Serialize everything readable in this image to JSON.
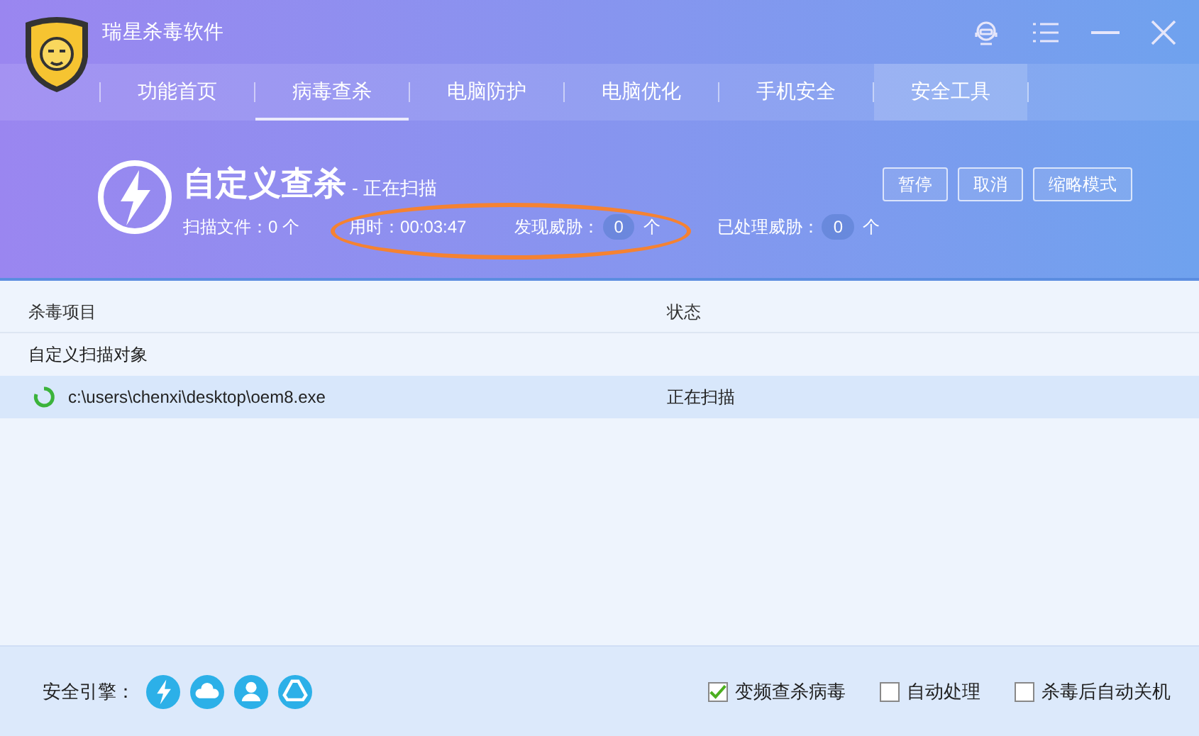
{
  "window": {
    "title": "瑞星杀毒软件"
  },
  "tabs": [
    {
      "label": "功能首页",
      "selected": false,
      "hovered": false
    },
    {
      "label": "病毒查杀",
      "selected": true,
      "hovered": false
    },
    {
      "label": "电脑防护",
      "selected": false,
      "hovered": false
    },
    {
      "label": "电脑优化",
      "selected": false,
      "hovered": false
    },
    {
      "label": "手机安全",
      "selected": false,
      "hovered": false
    },
    {
      "label": "安全工具",
      "selected": false,
      "hovered": true
    }
  ],
  "scan": {
    "title": "自定义查杀",
    "subtitle": "- 正在扫描",
    "stats": [
      {
        "label": "扫描文件：0 个",
        "kind": "plain"
      },
      {
        "label": "用时：00:03:47",
        "kind": "plain"
      },
      {
        "label": "发现威胁：",
        "count": "0",
        "unit": "个",
        "kind": "badge"
      },
      {
        "label": "已处理威胁：",
        "count": "0",
        "unit": "个",
        "kind": "badge"
      }
    ],
    "buttons": [
      "暂停",
      "取消",
      "缩略模式"
    ]
  },
  "table": {
    "columns": [
      "杀毒项目",
      "状态"
    ],
    "rows": [
      {
        "kind": "group",
        "item": "自定义扫描对象",
        "status": ""
      },
      {
        "kind": "file",
        "item": "c:\\users\\chenxi\\desktop\\oem8.exe",
        "status": "正在扫描",
        "selected": true
      }
    ]
  },
  "footer": {
    "engine_label": "安全引擎：",
    "options": [
      {
        "label": "变频查杀病毒",
        "checked": true
      },
      {
        "label": "自动处理",
        "checked": false
      },
      {
        "label": "杀毒后自动关机",
        "checked": false
      }
    ]
  }
}
